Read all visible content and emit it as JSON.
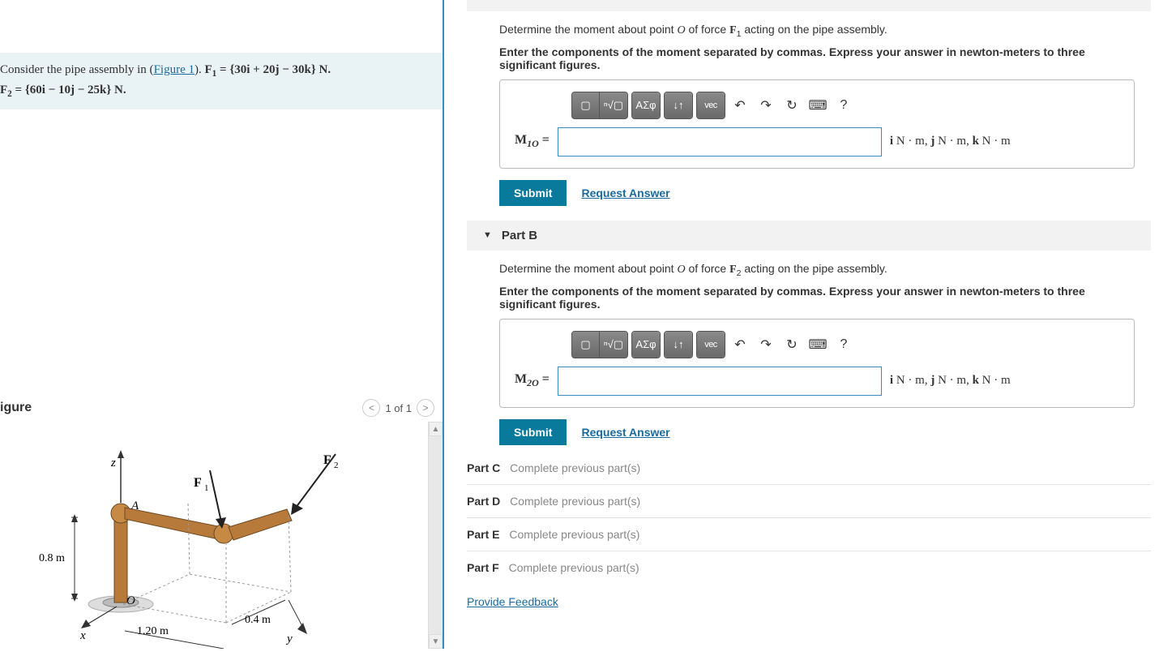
{
  "problem": {
    "intro": "Consider the pipe assembly in (",
    "figure_link": "Figure 1",
    "after_link": "). ",
    "f1_label": "F",
    "f1_sub": "1",
    "f1_eq": " = {30i + 20j − 30k} N.",
    "f2_label": "F",
    "f2_sub": "2",
    "f2_eq": " = {60i − 10j − 25k} N."
  },
  "figure": {
    "title": "igure",
    "nav_text": "1 of 1",
    "labels": {
      "z": "z",
      "x": "x",
      "y": "y",
      "A": "A",
      "O": "O",
      "F1": "F₁",
      "F2": "F₂",
      "d1": "0.8 m",
      "d2": "1.20 m",
      "d3": "0.4 m"
    }
  },
  "partA": {
    "question_pre": "Determine the moment about point ",
    "question_mid": " of force ",
    "question_post": " acting on the pipe assembly.",
    "O": "O",
    "F": "F",
    "Fsub": "1",
    "instruction": "Enter the components of the moment separated by commas. Express your answer in newton-meters to three significant figures.",
    "var_pre": "M",
    "var_sub": "1O",
    "var_eq": " =",
    "units": "i N · m, j N · m, k N · m",
    "submit": "Submit",
    "request": "Request Answer"
  },
  "partB": {
    "header": "Part B",
    "question_pre": "Determine the moment about point ",
    "question_mid": " of force ",
    "question_post": " acting on the pipe assembly.",
    "O": "O",
    "F": "F",
    "Fsub": "2",
    "instruction": "Enter the components of the moment separated by commas. Express your answer in newton-meters to three significant figures.",
    "var_pre": "M",
    "var_sub": "2O",
    "var_eq": " =",
    "units": "i N · m, j N · m, k N · m",
    "submit": "Submit",
    "request": "Request Answer"
  },
  "locked": [
    {
      "label": "Part C",
      "msg": "Complete previous part(s)"
    },
    {
      "label": "Part D",
      "msg": "Complete previous part(s)"
    },
    {
      "label": "Part E",
      "msg": "Complete previous part(s)"
    },
    {
      "label": "Part F",
      "msg": "Complete previous part(s)"
    }
  ],
  "toolbar": {
    "sqrt": "ⁿ√▢",
    "greek": "ΑΣφ",
    "arrows": "↓↑",
    "vec": "vec",
    "undo": "↶",
    "redo": "↷",
    "reset": "↻",
    "keyboard": "⌨",
    "help": "?"
  },
  "feedback": "Provide Feedback"
}
